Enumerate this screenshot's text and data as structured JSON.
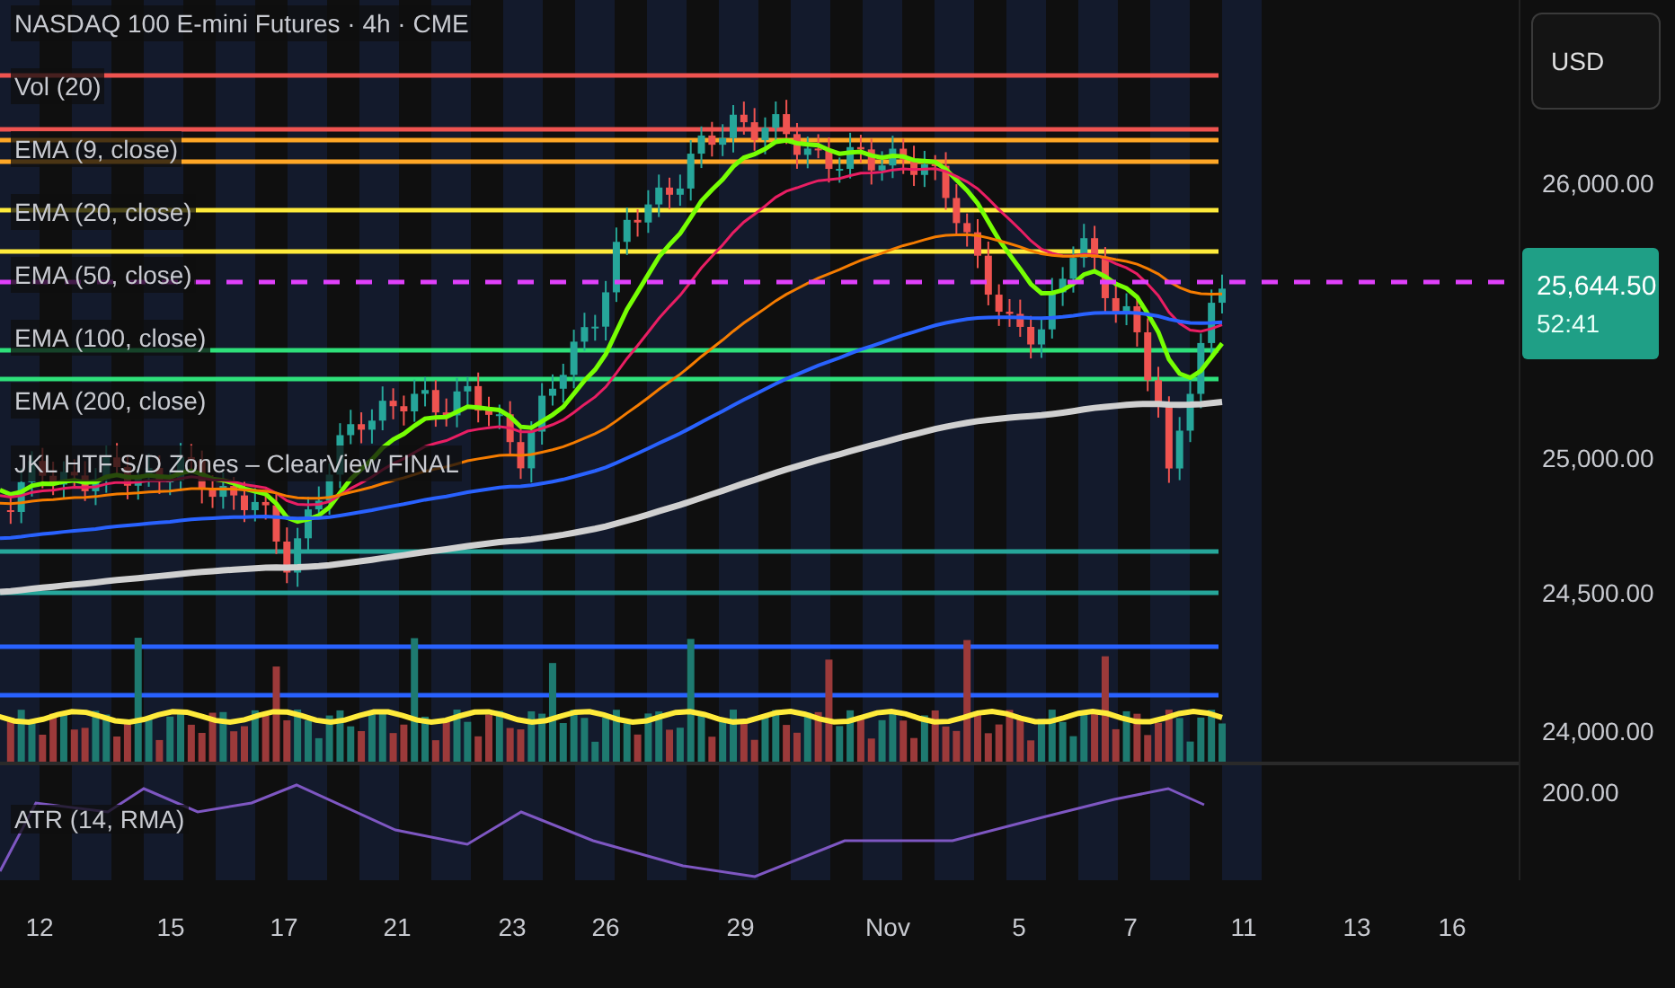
{
  "legend": {
    "symbol": "NASDAQ 100 E-mini Futures · 4h · CME",
    "indicators": [
      "Vol (20)",
      "EMA (9, close)",
      "EMA (20, close)",
      "EMA (50, close)",
      "EMA (100, close)",
      "EMA (200, close)",
      "JKL HTF S/D Zones – ClearView FINAL"
    ]
  },
  "price_axis": {
    "currency": "USD",
    "ticks": [
      "26,000.00",
      "25,000.00",
      "24,500.00",
      "24,000.00"
    ],
    "last_price": "25,644.50",
    "countdown": "52:41"
  },
  "atr_pane": {
    "label": "ATR (14, RMA)",
    "tick": "200.00"
  },
  "time_axis": [
    "12",
    "15",
    "17",
    "21",
    "23",
    "26",
    "29",
    "Nov",
    "5",
    "7",
    "11",
    "13",
    "16"
  ]
}
